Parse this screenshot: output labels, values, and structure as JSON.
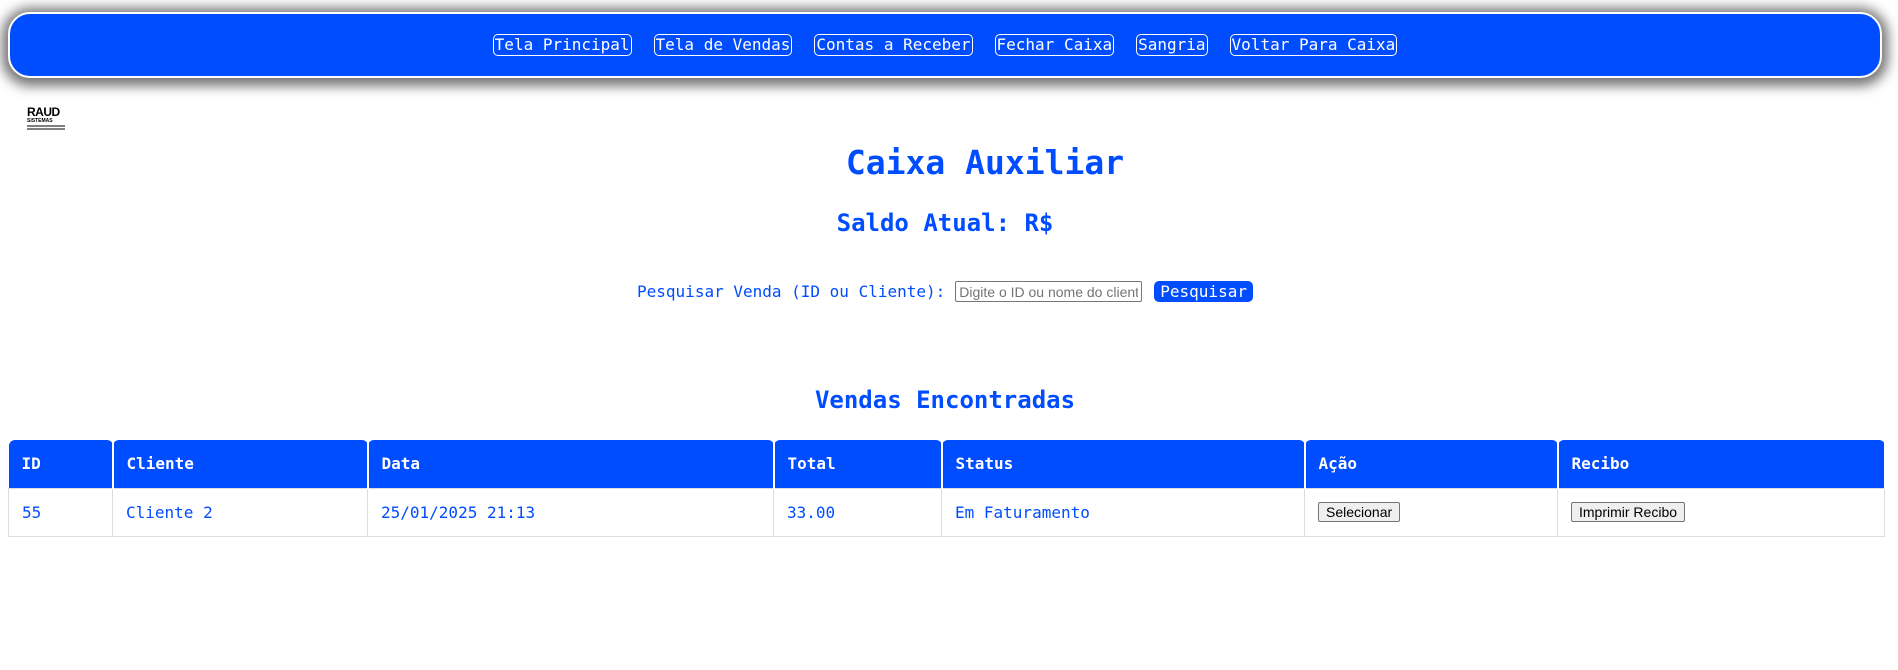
{
  "nav": {
    "items": [
      {
        "label": "Tela Principal"
      },
      {
        "label": "Tela de Vendas"
      },
      {
        "label": "Contas a Receber"
      },
      {
        "label": "Fechar Caixa"
      },
      {
        "label": "Sangria"
      },
      {
        "label": "Voltar Para Caixa"
      }
    ]
  },
  "logo": {
    "line1": "RAUD",
    "line2": "SISTEMAS"
  },
  "page": {
    "title": "Caixa Auxiliar",
    "balance_label": "Saldo Atual: R$"
  },
  "search": {
    "label": "Pesquisar Venda (ID ou Cliente):",
    "placeholder": "Digite o ID ou nome do cliente",
    "button_label": "Pesquisar"
  },
  "results": {
    "title": "Vendas Encontradas",
    "columns": [
      "ID",
      "Cliente",
      "Data",
      "Total",
      "Status",
      "Ação",
      "Recibo"
    ],
    "rows": [
      {
        "id": "55",
        "cliente": "Cliente 2",
        "data": "25/01/2025 21:13",
        "total": "33.00",
        "status": "Em Faturamento",
        "acao_label": "Selecionar",
        "recibo_label": "Imprimir Recibo"
      }
    ]
  },
  "colors": {
    "primary": "#004cff",
    "background": "#ffffff"
  }
}
